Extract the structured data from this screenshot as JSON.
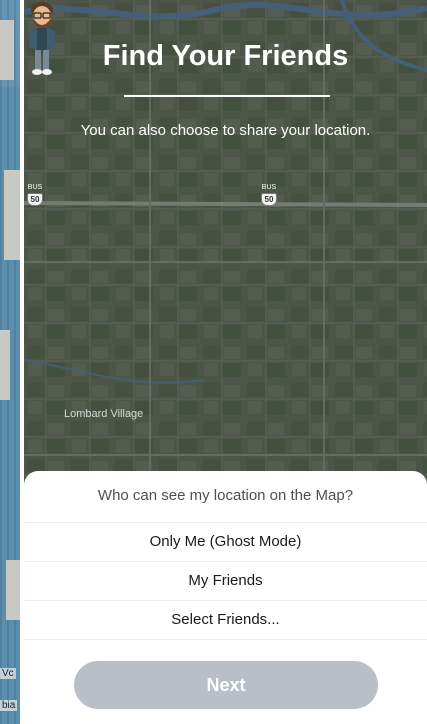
{
  "screen": {
    "title": "Find Your Friends",
    "subtitle": "You can also choose to share your location.",
    "back_icon": "chevron-left-icon",
    "map": {
      "place_label": "Lombard Village",
      "route_shields": [
        {
          "top": "BUS",
          "number": "50"
        },
        {
          "top": "BUS",
          "number": "50"
        }
      ]
    }
  },
  "left_strip": {
    "labels": [
      "Vc",
      "bia"
    ]
  },
  "sheet": {
    "question": "Who can see my location on the Map?",
    "options": [
      "Only Me (Ghost Mode)",
      "My Friends",
      "Select Friends..."
    ],
    "next_label": "Next"
  },
  "colors": {
    "map_bg": "#566050",
    "next_disabled": "#b9bec7",
    "water": "#5b8fb0"
  }
}
